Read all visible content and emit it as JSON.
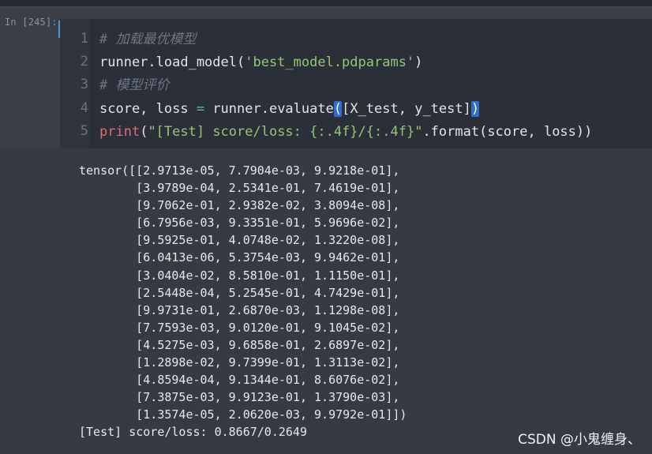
{
  "cell": {
    "prompt": "In [245]:",
    "lines": [
      {
        "num": "1",
        "comment": "# 加载最优模型"
      },
      {
        "num": "2",
        "pre": "runner.load_model(",
        "str": "'best_model.pdparams'",
        "post": ")"
      },
      {
        "num": "3",
        "comment": "# 模型评价"
      },
      {
        "num": "4",
        "pre": "score, loss ",
        "op": "=",
        "mid": " runner.evaluate",
        "bl": "(",
        "inner": "[X_test, y_test]",
        "br": ")"
      },
      {
        "num": "5",
        "kw": "print",
        "open": "(",
        "str": "\"[Test] score/loss: {:.4f}/{:.4f}\"",
        "post": ".format(score, loss))"
      }
    ]
  },
  "output": {
    "lines": [
      "tensor([[2.9713e-05, 7.7904e-03, 9.9218e-01],",
      "        [3.9789e-04, 2.5341e-01, 7.4619e-01],",
      "        [9.7062e-01, 2.9382e-02, 3.8094e-08],",
      "        [6.7956e-03, 9.3351e-01, 5.9696e-02],",
      "        [9.5925e-01, 4.0748e-02, 1.3220e-08],",
      "        [6.0413e-06, 5.3754e-03, 9.9462e-01],",
      "        [3.0404e-02, 8.5810e-01, 1.1150e-01],",
      "        [2.5448e-04, 5.2545e-01, 4.7429e-01],",
      "        [9.9731e-01, 2.6870e-03, 1.1298e-08],",
      "        [7.7593e-03, 9.0120e-01, 9.1045e-02],",
      "        [4.5275e-03, 9.6858e-01, 2.6897e-02],",
      "        [1.2898e-02, 9.7399e-01, 1.3113e-02],",
      "        [4.8594e-04, 9.1344e-01, 8.6076e-02],",
      "        [7.3875e-03, 9.9123e-01, 1.3790e-03],",
      "        [1.3574e-05, 2.0620e-03, 9.9792e-01]])",
      "[Test] score/loss: 0.8667/0.2649"
    ]
  },
  "watermark": "CSDN @小鬼缠身、"
}
